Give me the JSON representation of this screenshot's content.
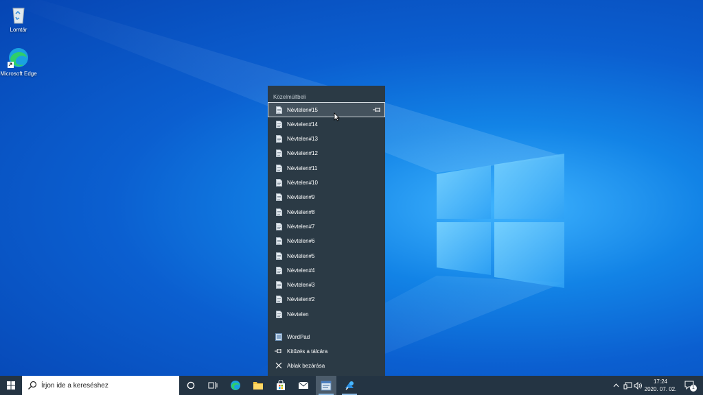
{
  "desktop": {
    "icons": [
      {
        "label": "Lomtár",
        "icon": "recycle-bin-icon"
      },
      {
        "label": "Microsoft Edge",
        "icon": "edge-icon"
      }
    ]
  },
  "jumplist": {
    "header": "Közelmúltbeli",
    "recent": [
      "Névtelen#15",
      "Névtelen#14",
      "Névtelen#13",
      "Névtelen#12",
      "Névtelen#11",
      "Névtelen#10",
      "Névtelen#9",
      "Névtelen#8",
      "Névtelen#7",
      "Névtelen#6",
      "Névtelen#5",
      "Névtelen#4",
      "Névtelen#3",
      "Névtelen#2",
      "Névtelen"
    ],
    "selected_index": 0,
    "tasks": [
      {
        "label": "WordPad",
        "icon": "wordpad-icon"
      },
      {
        "label": "Kitűzés a tálcára",
        "icon": "pin-icon"
      },
      {
        "label": "Ablak bezárása",
        "icon": "close-icon"
      }
    ]
  },
  "taskbar": {
    "search_placeholder": "Írjon ide a kereséshez",
    "apps": [
      "cortana-icon",
      "task-view-icon",
      "edge-icon",
      "file-explorer-icon",
      "store-icon",
      "mail-icon",
      "wordpad-icon",
      "paint3d-icon"
    ],
    "active_app": "wordpad-icon",
    "time": "17:24",
    "date": "2020. 07. 02.",
    "notification_count": "1"
  },
  "colors": {
    "accent": "#0b5fd0",
    "taskbar": "#243443",
    "jumplist": "#2b3a45"
  }
}
